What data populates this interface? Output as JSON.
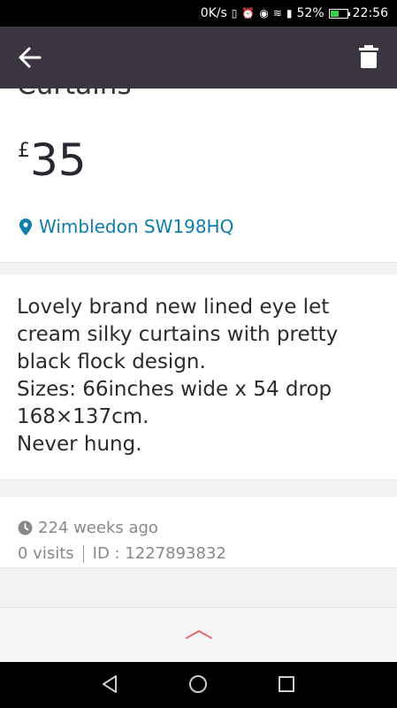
{
  "status_bar": {
    "speed": "0K/s",
    "battery": "52%",
    "battery_level": 0.52,
    "time": "22:56",
    "icons": [
      "vibrate-icon",
      "alarm-icon",
      "eye-icon",
      "wifi-icon",
      "signal-icon",
      "battery-icon"
    ]
  },
  "app_bar": {
    "back_icon": "arrow-left-icon",
    "delete_icon": "trash-icon"
  },
  "listing": {
    "title": "Curtains",
    "currency": "£",
    "price": "35",
    "location": "Wimbledon SW198HQ",
    "description": [
      "Lovely brand new lined eye let",
      "cream silky curtains with pretty",
      "black flock design.",
      "Sizes: 66inches wide x 54 drop",
      "168×137cm.",
      "Never hung."
    ],
    "posted": "224 weeks ago",
    "visits": "0 visits",
    "id": "ID : 1227893832"
  },
  "colors": {
    "app_bar": "#3b3441",
    "location": "#0f7ea9",
    "chevron": "#e46a6a"
  }
}
